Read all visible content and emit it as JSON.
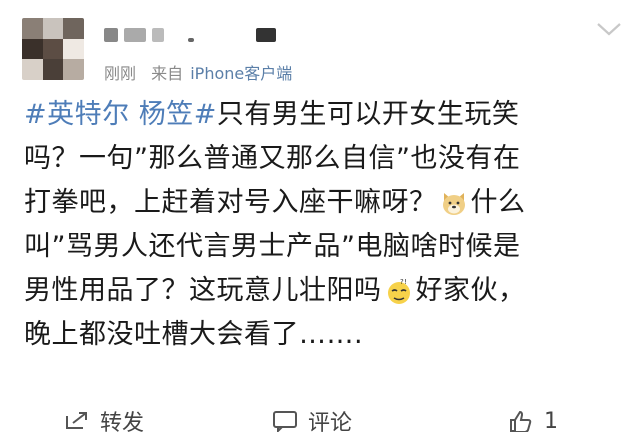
{
  "post": {
    "time": "刚刚",
    "source_prefix": "来自",
    "source_app": "iPhone客户端",
    "content_lines": [
      {
        "topic": "#英特尔 杨笠#",
        "text": "只有男生可以开女生玩笑"
      },
      {
        "text": "吗？一句”那么普通又那么自信”也没有在"
      },
      {
        "text_before": "打拳吧，上赶着对号入座干嘛呀？",
        "emoji": "doge-emoji",
        "text_after": "什么"
      },
      {
        "text": "叫”骂男人还代言男士产品”电脑啥时候是"
      },
      {
        "text_before": "男性用品了？这玩意儿壮阳吗",
        "emoji": "thinking-emoji",
        "text_after": "好家伙，"
      },
      {
        "text": "晚上都没吐槽大会看了……."
      }
    ]
  },
  "actions": {
    "repost_label": "转发",
    "comment_label": "评论",
    "like_count": "1"
  },
  "colors": {
    "topic": "#4e7db8",
    "source_link": "#5b7fa8",
    "meta": "#8a8a8a"
  }
}
